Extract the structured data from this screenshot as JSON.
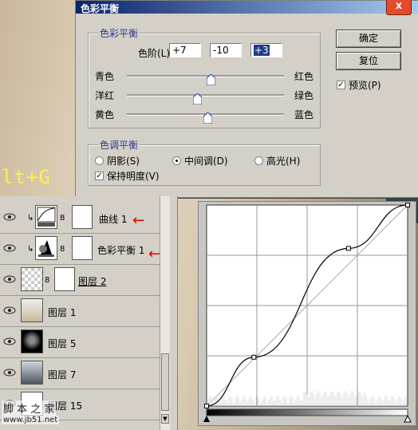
{
  "hotkey": "lt+G",
  "dialog": {
    "title": "色彩平衡",
    "close": "x",
    "color_balance_group": "色彩平衡",
    "levels_label": "色阶(L):",
    "level_values": [
      "+7",
      "-10",
      "+3"
    ],
    "sliders": [
      {
        "left": "青色",
        "right": "红色",
        "value": 7
      },
      {
        "left": "洋红",
        "right": "绿色",
        "value": -10
      },
      {
        "left": "黄色",
        "right": "蓝色",
        "value": 3
      }
    ],
    "tone_group": "色调平衡",
    "tones": [
      {
        "label": "阴影(S)",
        "checked": false
      },
      {
        "label": "中间调(D)",
        "checked": true
      },
      {
        "label": "高光(H)",
        "checked": false
      }
    ],
    "preserve_luminosity": "保持明度(V)",
    "ok": "确定",
    "reset": "复位",
    "preview": "预览(P)"
  },
  "layers": [
    {
      "name": "曲线 1",
      "type": "adjustment",
      "arrow": true
    },
    {
      "name": "色彩平衡 1",
      "type": "adjustment",
      "arrow": true
    },
    {
      "name": "图层 2",
      "type": "normal"
    },
    {
      "name": "图层 1",
      "type": "normal"
    },
    {
      "name": "图层 5",
      "type": "normal"
    },
    {
      "name": "图层 7",
      "type": "normal"
    },
    {
      "name": "图层 15",
      "type": "normal"
    }
  ],
  "watermark": {
    "text": "脚 本 之 家",
    "url": "www.jb51.net"
  },
  "curve": {
    "points": [
      [
        0,
        0
      ],
      [
        60,
        62
      ],
      [
        180,
        200
      ],
      [
        255,
        255
      ]
    ]
  }
}
